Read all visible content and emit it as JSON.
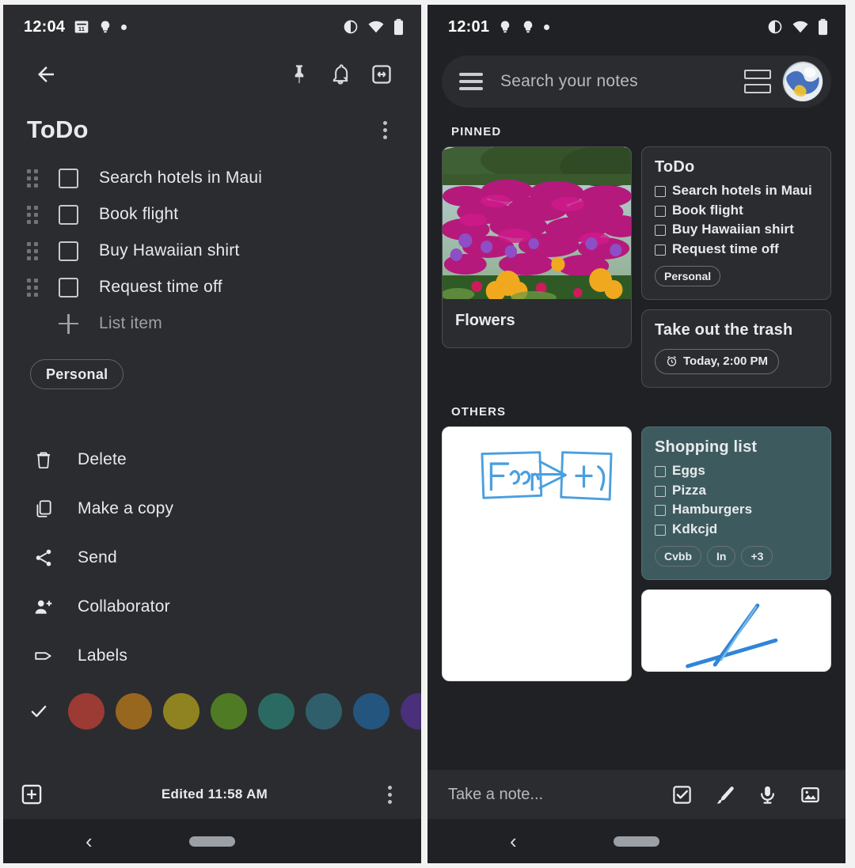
{
  "left": {
    "status": {
      "time": "12:04",
      "icons": [
        "calendar-icon",
        "bulb-icon",
        "dot-icon"
      ],
      "right_icons": [
        "contrast-icon",
        "wifi-icon",
        "battery-icon"
      ]
    },
    "appbar": {
      "back": "back-arrow-icon",
      "pin": "pin-icon",
      "reminder": "bell-icon",
      "archive": "archive-icon"
    },
    "note": {
      "title": "ToDo",
      "menu": "more-options",
      "items": [
        {
          "text": "Search hotels in Maui",
          "checked": false
        },
        {
          "text": "Book flight",
          "checked": false
        },
        {
          "text": "Buy Hawaiian shirt",
          "checked": false
        },
        {
          "text": "Request time off",
          "checked": false
        }
      ],
      "add_placeholder": "List item",
      "label": "Personal",
      "edited": "Edited 11:58 AM"
    },
    "menu_items": [
      {
        "icon": "trash-icon",
        "label": "Delete"
      },
      {
        "icon": "copy-icon",
        "label": "Make a copy"
      },
      {
        "icon": "share-icon",
        "label": "Send"
      },
      {
        "icon": "person-add-icon",
        "label": "Collaborator"
      },
      {
        "icon": "tag-icon",
        "label": "Labels"
      }
    ],
    "colors": [
      {
        "name": "default",
        "hex": "#2b2c2f",
        "selected": true
      },
      {
        "name": "coral",
        "hex": "#9c3a34"
      },
      {
        "name": "peach",
        "hex": "#97661f"
      },
      {
        "name": "sand",
        "hex": "#8f8220"
      },
      {
        "name": "mint",
        "hex": "#4f7b25"
      },
      {
        "name": "sage",
        "hex": "#2a6a62"
      },
      {
        "name": "fog",
        "hex": "#2f5f6b"
      },
      {
        "name": "storm",
        "hex": "#24557f"
      },
      {
        "name": "dusk",
        "hex": "#4a2f7a"
      }
    ],
    "bottom": {
      "add_icon": "add-box-icon",
      "more_icon": "more-options-icon"
    },
    "nav": {
      "back": "nav-back-icon",
      "home": "nav-home-pill"
    }
  },
  "right": {
    "status": {
      "time": "12:01",
      "icons": [
        "bulb-icon",
        "bulb-icon",
        "dot-icon"
      ],
      "right_icons": [
        "contrast-icon",
        "wifi-icon",
        "battery-icon"
      ]
    },
    "search": {
      "placeholder": "Search your notes",
      "menu_icon": "hamburger-icon",
      "view_icon": "list-view-icon",
      "avatar": "account-avatar"
    },
    "sections": [
      {
        "label": "PINNED"
      },
      {
        "label": "OTHERS"
      }
    ],
    "pinned": {
      "photo_note": {
        "caption": "Flowers",
        "image": "flowers-photo"
      },
      "todo_note": {
        "title": "ToDo",
        "items": [
          "Search hotels in Maui",
          "Book flight",
          "Buy Hawaiian shirt",
          "Request time off"
        ],
        "chips": [
          "Personal"
        ]
      },
      "trash_note": {
        "title": "Take out the trash",
        "reminder": "Today, 2:00 PM",
        "reminder_icon": "alarm-icon"
      }
    },
    "others": {
      "drawing_note": {
        "name": "drawing-note-diagram"
      },
      "shopping_note": {
        "title": "Shopping list",
        "items": [
          "Eggs",
          "Pizza",
          "Hamburgers",
          "Kdkcjd"
        ],
        "chips": [
          "Cvbb",
          "In",
          "+3"
        ],
        "color": "#3d5b5e"
      },
      "scribble_note": {
        "name": "scribble-note"
      }
    },
    "takenote": {
      "placeholder": "Take a note...",
      "actions": [
        "checkbox-icon",
        "brush-icon",
        "mic-icon",
        "image-icon"
      ]
    },
    "nav": {
      "back": "nav-back-icon",
      "home": "nav-home-pill"
    }
  }
}
